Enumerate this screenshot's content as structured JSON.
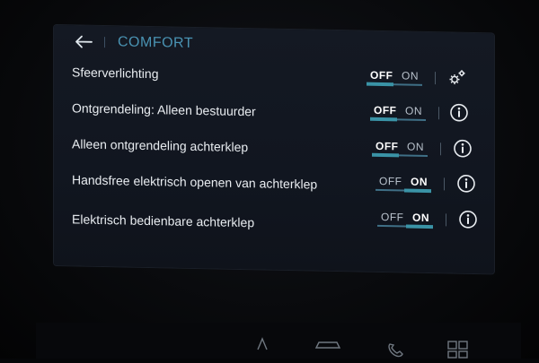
{
  "header": {
    "back_icon": "arrow-left-icon",
    "title": "COMFORT"
  },
  "settings": [
    {
      "label": "Sfeerverlichting",
      "off_label": "OFF",
      "on_label": "ON",
      "state": "OFF",
      "action_icon": "gear-icon"
    },
    {
      "label": "Ontgrendeling: Alleen bestuurder",
      "off_label": "OFF",
      "on_label": "ON",
      "state": "OFF",
      "action_icon": "info-icon"
    },
    {
      "label": "Alleen ontgrendeling achterklep",
      "off_label": "OFF",
      "on_label": "ON",
      "state": "OFF",
      "action_icon": "info-icon"
    },
    {
      "label": "Handsfree elektrisch openen van achterklep",
      "off_label": "OFF",
      "on_label": "ON",
      "state": "ON",
      "action_icon": "info-icon"
    },
    {
      "label": "Elektrisch bedienbare achterklep",
      "off_label": "OFF",
      "on_label": "ON",
      "state": "ON",
      "action_icon": "info-icon"
    }
  ],
  "colors": {
    "accent": "#4a93b3",
    "toggle_bar": "#3a93a6",
    "text": "#e8ecf0",
    "screen_bg": "#121722"
  }
}
